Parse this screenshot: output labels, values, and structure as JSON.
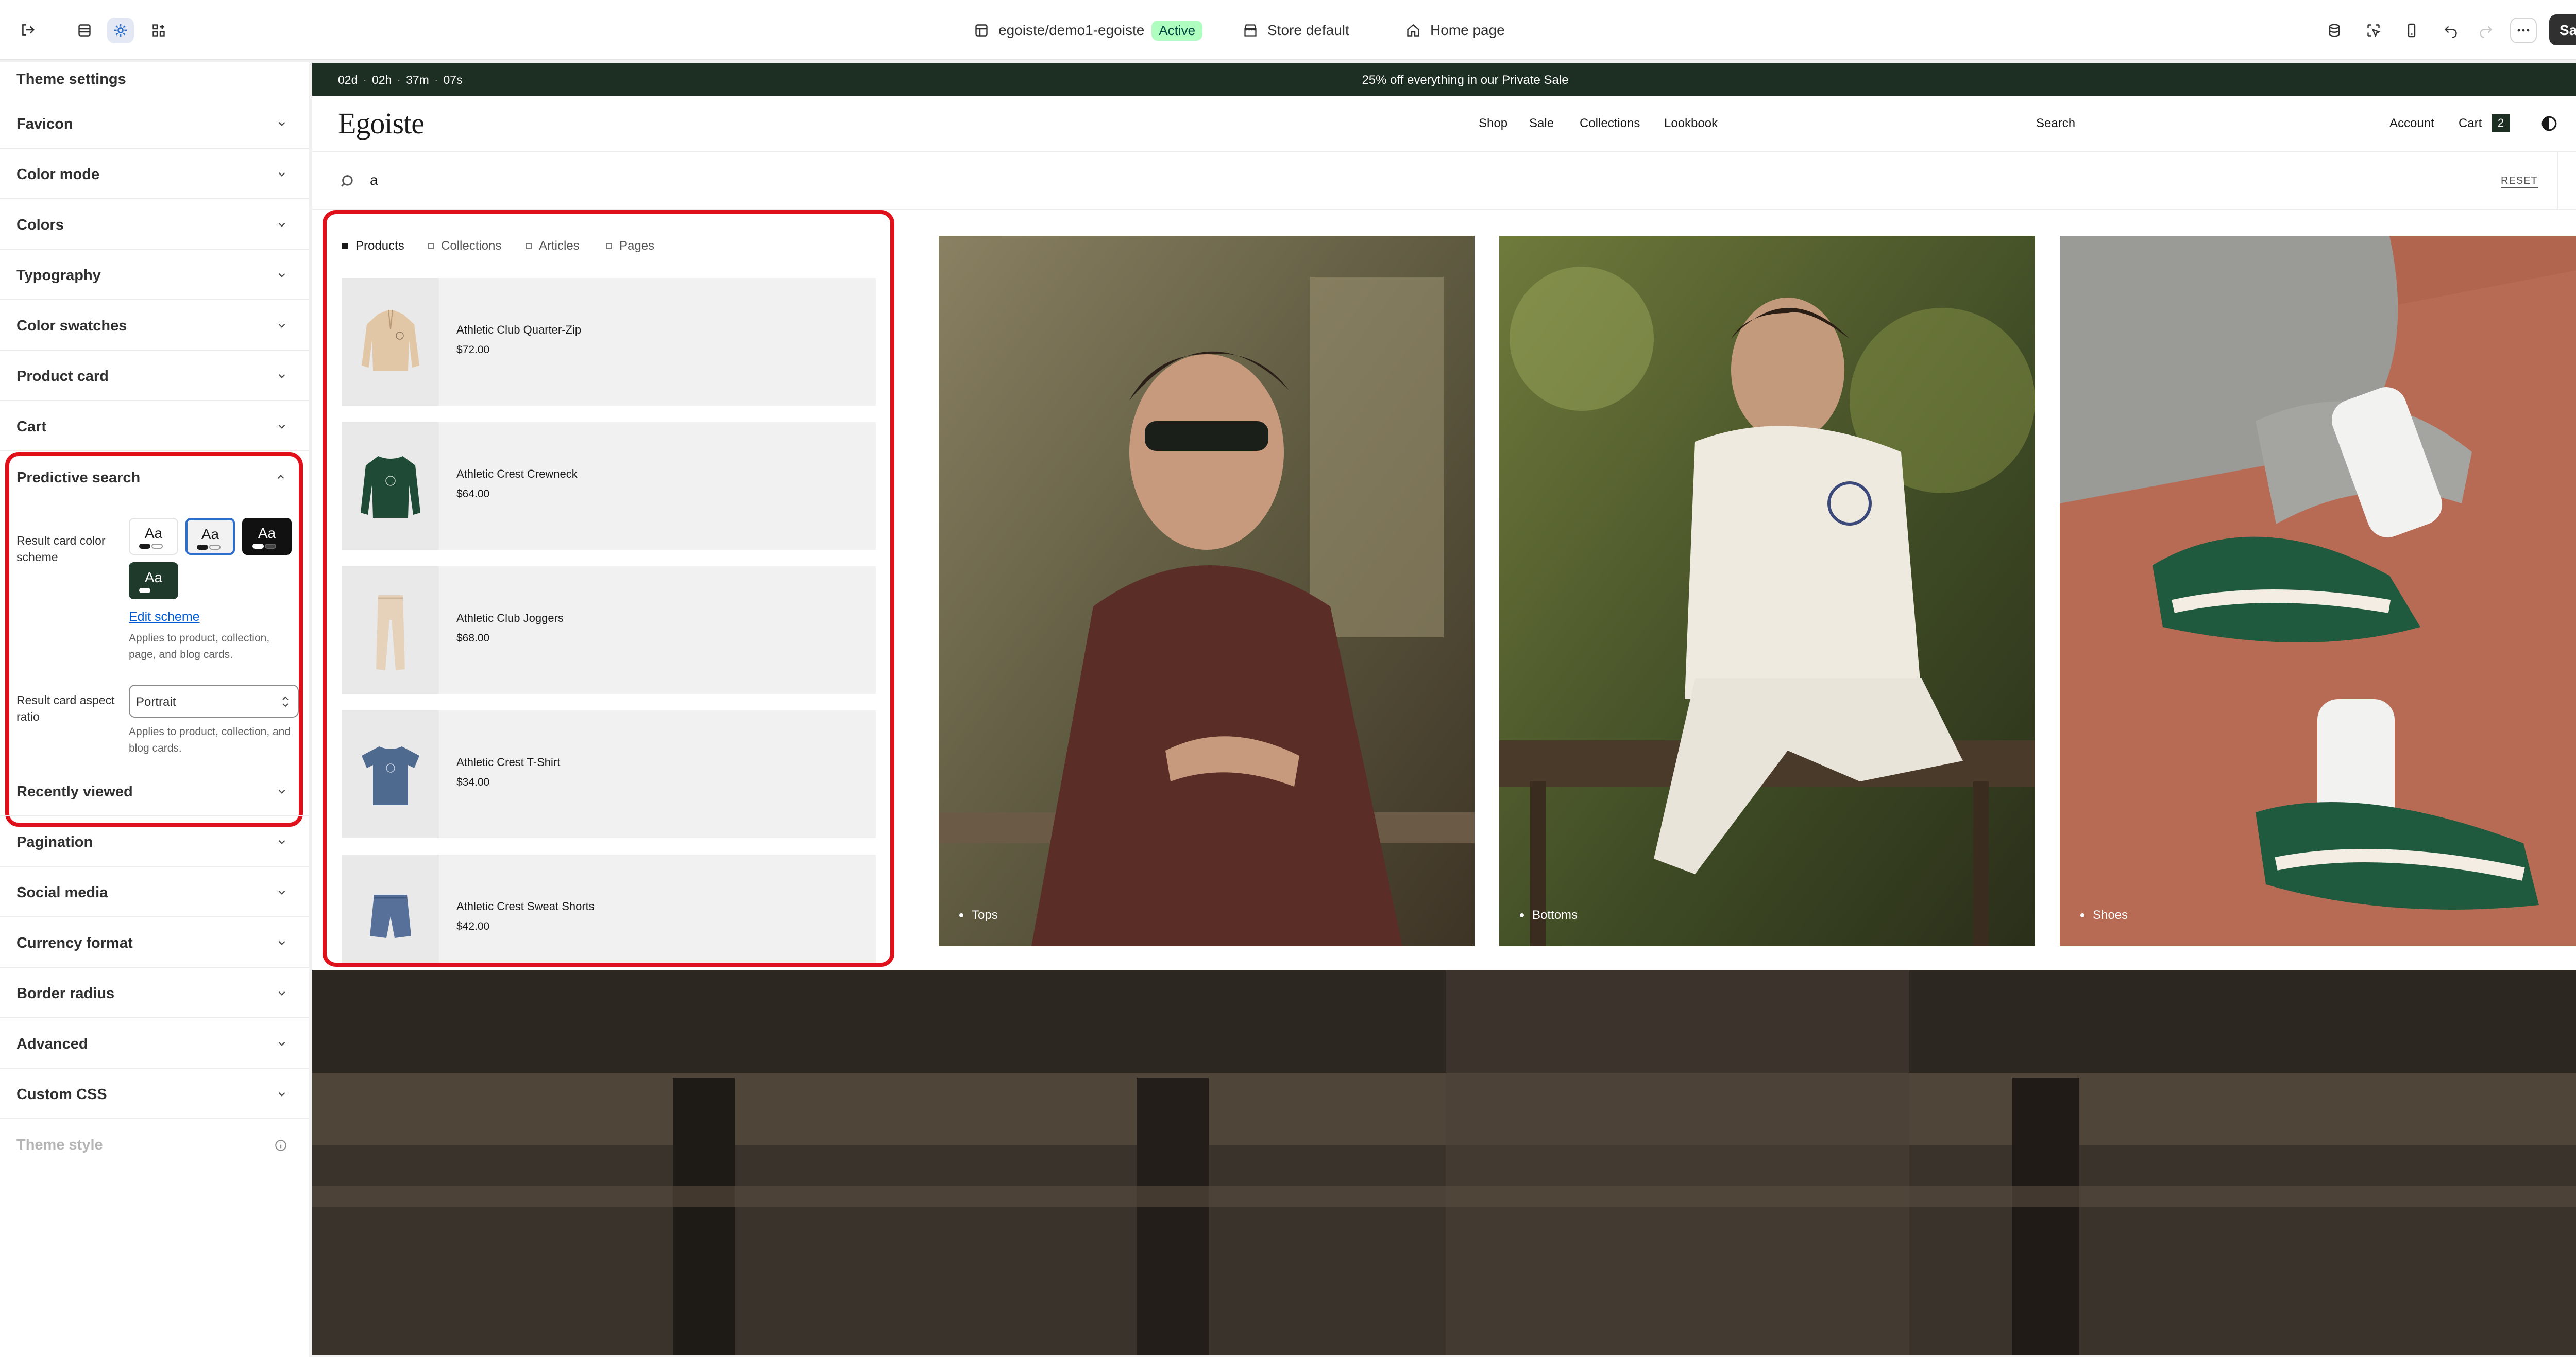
{
  "topbar": {
    "store": "egoiste/demo1-egoiste",
    "status": "Active",
    "theme": "Store default",
    "page": "Home page",
    "save_label": "Save",
    "icons": [
      "exit-icon",
      "sections-icon",
      "settings-icon",
      "apps-icon",
      "database-icon",
      "inspector-icon",
      "mobile-icon",
      "undo-icon",
      "redo-icon",
      "more-icon"
    ]
  },
  "sidebar": {
    "title": "Theme settings",
    "sections_top": [
      "Favicon",
      "Color mode",
      "Colors",
      "Typography",
      "Color swatches",
      "Product card",
      "Cart"
    ],
    "predictive": {
      "title": "Predictive search",
      "scheme_label": "Result card color scheme",
      "swatch_text": "Aa",
      "edit_link": "Edit scheme",
      "scheme_help": "Applies to product, collection, page, and blog cards.",
      "aspect_label": "Result card aspect ratio",
      "aspect_value": "Portrait",
      "aspect_help": "Applies to product, collection, and blog cards."
    },
    "sections_bottom": [
      "Recently viewed",
      "Pagination",
      "Social media",
      "Currency format",
      "Border radius",
      "Advanced",
      "Custom CSS"
    ],
    "theme_style": "Theme style"
  },
  "preview": {
    "countdown": [
      "02d",
      "02h",
      "37m",
      "07s"
    ],
    "announcement": "25% off everything in our Private Sale",
    "logo": "Egoiste",
    "nav": [
      "Shop",
      "Sale",
      "Collections",
      "Lookbook"
    ],
    "search_link": "Search",
    "account": "Account",
    "cart": "Cart",
    "cart_count": "2",
    "query": "a",
    "reset": "RESET",
    "tabs": [
      "Products",
      "Collections",
      "Articles",
      "Pages"
    ],
    "products": [
      {
        "name": "Athletic Club Quarter-Zip",
        "price": "$72.00"
      },
      {
        "name": "Athletic Crest Crewneck",
        "price": "$64.00"
      },
      {
        "name": "Athletic Club Joggers",
        "price": "$68.00"
      },
      {
        "name": "Athletic Crest T-Shirt",
        "price": "$34.00"
      },
      {
        "name": "Athletic Crest Sweat Shorts",
        "price": "$42.00"
      }
    ],
    "collections": [
      "Tops",
      "Bottoms",
      "Shoes"
    ]
  },
  "colors": {
    "accent_red": "#e0101a",
    "announcement_bg": "#1c2f22",
    "active_badge": "#affebf",
    "link_blue": "#005bd3"
  }
}
